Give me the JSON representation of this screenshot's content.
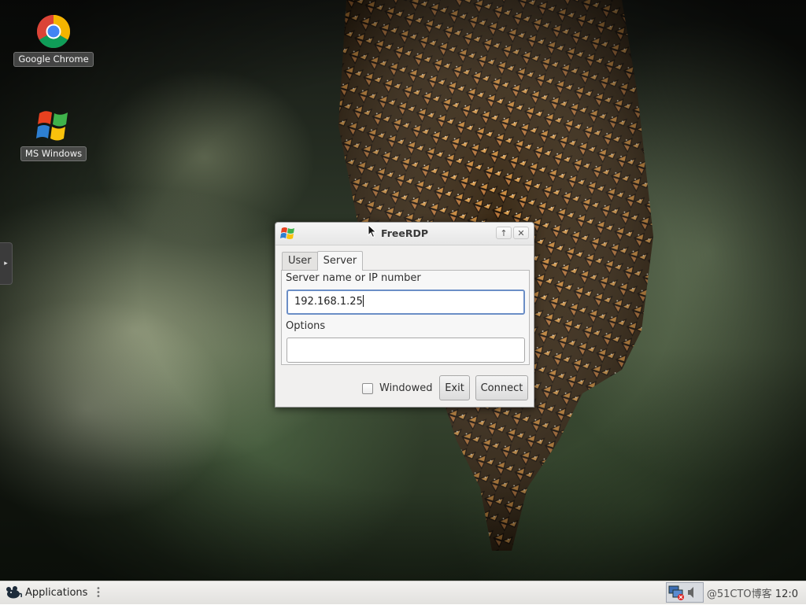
{
  "desktop": {
    "icons": [
      {
        "label": "Google Chrome",
        "icon": "chrome-icon"
      },
      {
        "label": "MS Windows",
        "icon": "windows-logo-icon"
      }
    ],
    "side_panel_toggle": "▸"
  },
  "dialog": {
    "title": "FreeRDP",
    "controls": {
      "maximize": "↑",
      "close": "✕"
    },
    "tabs": [
      {
        "label": "User",
        "active": false
      },
      {
        "label": "Server",
        "active": true
      }
    ],
    "server_label": "Server name or IP number",
    "server_value": "192.168.1.25",
    "options_label": "Options",
    "options_value": "",
    "windowed_label": "Windowed",
    "windowed_checked": false,
    "exit_label": "Exit",
    "connect_label": "Connect"
  },
  "taskbar": {
    "applications_label": "Applications",
    "clock": "12:0",
    "watermark": "@51CTO博客"
  },
  "colors": {
    "focus_border": "#6b8ec6",
    "dialog_bg": "#f1f0ef",
    "taskbar_bg": "#e8e7e4"
  }
}
